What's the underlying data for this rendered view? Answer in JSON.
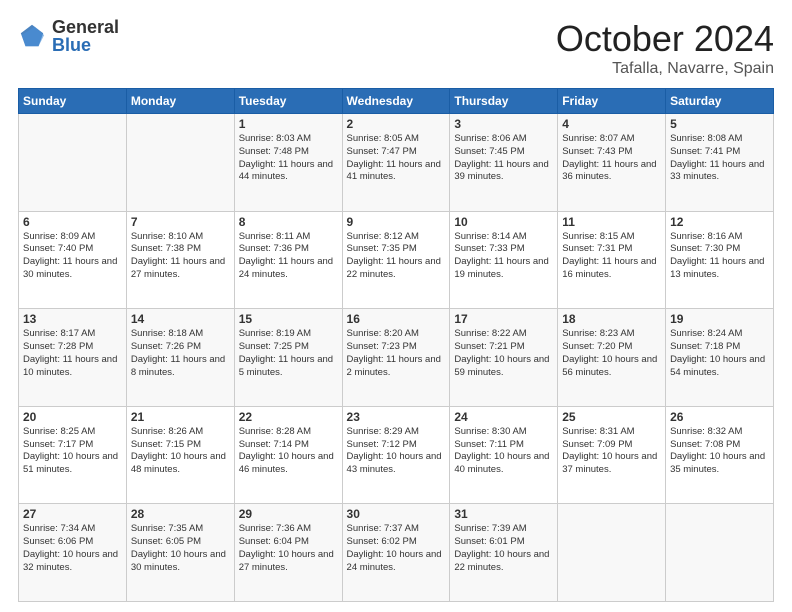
{
  "header": {
    "logo_general": "General",
    "logo_blue": "Blue",
    "month_title": "October 2024",
    "location": "Tafalla, Navarre, Spain"
  },
  "days_of_week": [
    "Sunday",
    "Monday",
    "Tuesday",
    "Wednesday",
    "Thursday",
    "Friday",
    "Saturday"
  ],
  "weeks": [
    [
      {
        "day": "",
        "text": ""
      },
      {
        "day": "",
        "text": ""
      },
      {
        "day": "1",
        "text": "Sunrise: 8:03 AM\nSunset: 7:48 PM\nDaylight: 11 hours and 44 minutes."
      },
      {
        "day": "2",
        "text": "Sunrise: 8:05 AM\nSunset: 7:47 PM\nDaylight: 11 hours and 41 minutes."
      },
      {
        "day": "3",
        "text": "Sunrise: 8:06 AM\nSunset: 7:45 PM\nDaylight: 11 hours and 39 minutes."
      },
      {
        "day": "4",
        "text": "Sunrise: 8:07 AM\nSunset: 7:43 PM\nDaylight: 11 hours and 36 minutes."
      },
      {
        "day": "5",
        "text": "Sunrise: 8:08 AM\nSunset: 7:41 PM\nDaylight: 11 hours and 33 minutes."
      }
    ],
    [
      {
        "day": "6",
        "text": "Sunrise: 8:09 AM\nSunset: 7:40 PM\nDaylight: 11 hours and 30 minutes."
      },
      {
        "day": "7",
        "text": "Sunrise: 8:10 AM\nSunset: 7:38 PM\nDaylight: 11 hours and 27 minutes."
      },
      {
        "day": "8",
        "text": "Sunrise: 8:11 AM\nSunset: 7:36 PM\nDaylight: 11 hours and 24 minutes."
      },
      {
        "day": "9",
        "text": "Sunrise: 8:12 AM\nSunset: 7:35 PM\nDaylight: 11 hours and 22 minutes."
      },
      {
        "day": "10",
        "text": "Sunrise: 8:14 AM\nSunset: 7:33 PM\nDaylight: 11 hours and 19 minutes."
      },
      {
        "day": "11",
        "text": "Sunrise: 8:15 AM\nSunset: 7:31 PM\nDaylight: 11 hours and 16 minutes."
      },
      {
        "day": "12",
        "text": "Sunrise: 8:16 AM\nSunset: 7:30 PM\nDaylight: 11 hours and 13 minutes."
      }
    ],
    [
      {
        "day": "13",
        "text": "Sunrise: 8:17 AM\nSunset: 7:28 PM\nDaylight: 11 hours and 10 minutes."
      },
      {
        "day": "14",
        "text": "Sunrise: 8:18 AM\nSunset: 7:26 PM\nDaylight: 11 hours and 8 minutes."
      },
      {
        "day": "15",
        "text": "Sunrise: 8:19 AM\nSunset: 7:25 PM\nDaylight: 11 hours and 5 minutes."
      },
      {
        "day": "16",
        "text": "Sunrise: 8:20 AM\nSunset: 7:23 PM\nDaylight: 11 hours and 2 minutes."
      },
      {
        "day": "17",
        "text": "Sunrise: 8:22 AM\nSunset: 7:21 PM\nDaylight: 10 hours and 59 minutes."
      },
      {
        "day": "18",
        "text": "Sunrise: 8:23 AM\nSunset: 7:20 PM\nDaylight: 10 hours and 56 minutes."
      },
      {
        "day": "19",
        "text": "Sunrise: 8:24 AM\nSunset: 7:18 PM\nDaylight: 10 hours and 54 minutes."
      }
    ],
    [
      {
        "day": "20",
        "text": "Sunrise: 8:25 AM\nSunset: 7:17 PM\nDaylight: 10 hours and 51 minutes."
      },
      {
        "day": "21",
        "text": "Sunrise: 8:26 AM\nSunset: 7:15 PM\nDaylight: 10 hours and 48 minutes."
      },
      {
        "day": "22",
        "text": "Sunrise: 8:28 AM\nSunset: 7:14 PM\nDaylight: 10 hours and 46 minutes."
      },
      {
        "day": "23",
        "text": "Sunrise: 8:29 AM\nSunset: 7:12 PM\nDaylight: 10 hours and 43 minutes."
      },
      {
        "day": "24",
        "text": "Sunrise: 8:30 AM\nSunset: 7:11 PM\nDaylight: 10 hours and 40 minutes."
      },
      {
        "day": "25",
        "text": "Sunrise: 8:31 AM\nSunset: 7:09 PM\nDaylight: 10 hours and 37 minutes."
      },
      {
        "day": "26",
        "text": "Sunrise: 8:32 AM\nSunset: 7:08 PM\nDaylight: 10 hours and 35 minutes."
      }
    ],
    [
      {
        "day": "27",
        "text": "Sunrise: 7:34 AM\nSunset: 6:06 PM\nDaylight: 10 hours and 32 minutes."
      },
      {
        "day": "28",
        "text": "Sunrise: 7:35 AM\nSunset: 6:05 PM\nDaylight: 10 hours and 30 minutes."
      },
      {
        "day": "29",
        "text": "Sunrise: 7:36 AM\nSunset: 6:04 PM\nDaylight: 10 hours and 27 minutes."
      },
      {
        "day": "30",
        "text": "Sunrise: 7:37 AM\nSunset: 6:02 PM\nDaylight: 10 hours and 24 minutes."
      },
      {
        "day": "31",
        "text": "Sunrise: 7:39 AM\nSunset: 6:01 PM\nDaylight: 10 hours and 22 minutes."
      },
      {
        "day": "",
        "text": ""
      },
      {
        "day": "",
        "text": ""
      }
    ]
  ]
}
